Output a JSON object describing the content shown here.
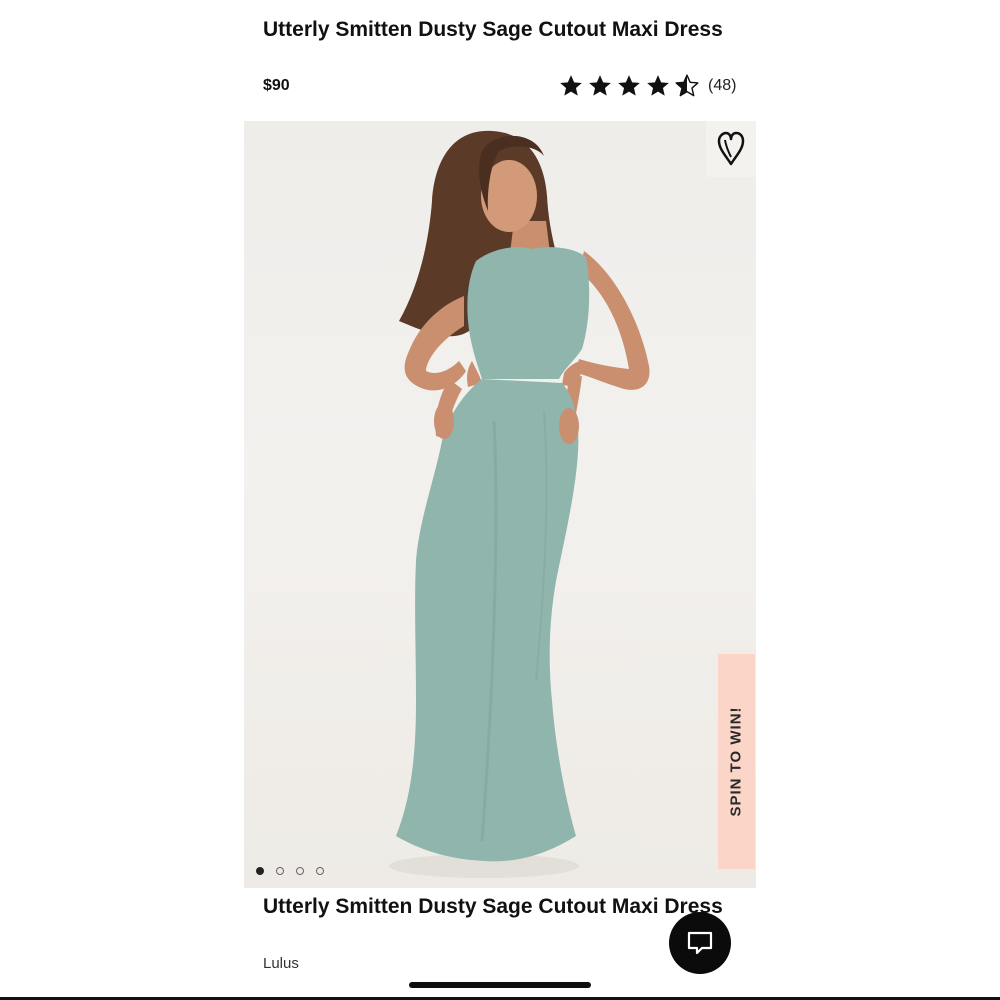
{
  "product": {
    "title": "Utterly Smitten Dusty Sage Cutout Maxi Dress",
    "price": "$90",
    "brand": "Lulus"
  },
  "rating": {
    "value": 4.5,
    "max": 5,
    "review_count": "(48)"
  },
  "icons": {
    "wishlist": "heart-icon",
    "chat": "chat-bubble-icon",
    "star": "star-icon"
  },
  "carousel": {
    "total_images": 4,
    "active_index": 0
  },
  "promo": {
    "spin_label": "SPIN TO WIN!"
  },
  "colors": {
    "dress": "#8fb5ac",
    "promo_tab": "#fbd6c8",
    "text": "#111111"
  }
}
